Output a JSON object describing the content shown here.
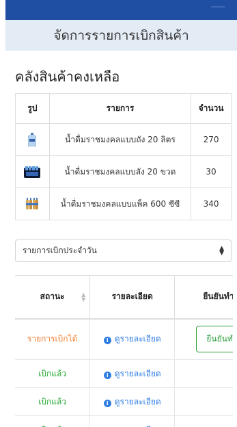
{
  "page_header": {
    "title": "จัดการรายการเบิกสินค้า"
  },
  "stock_section": {
    "title": "คลังสินค้าคงเหลือ",
    "columns": [
      "รูป",
      "รายการ",
      "จำนวน"
    ],
    "rows": [
      {
        "icon": "water-jug-icon",
        "name": "น้ำดื่มราชมงคลแบบถัง 20 ลิตร",
        "qty": "270"
      },
      {
        "icon": "bottle-crate-icon",
        "name": "น้ำดื่มราชมงคลแบบลัง 20 ขวด",
        "qty": "30"
      },
      {
        "icon": "bottle-pack-icon",
        "name": "น้ำดื่มราชมงคลแบบแพ็ค 600 ซีซี",
        "qty": "340"
      }
    ]
  },
  "filter": {
    "selected": "รายการเบิกประจำวัน"
  },
  "requests": {
    "columns": [
      "สถานะ",
      "รายละเอียด",
      "ยืนยันทำก"
    ],
    "detail_label": "ดูรายละเอียด",
    "confirm_label": "ยืนยันทำก",
    "rows": [
      {
        "status": "รายการเบิกได้",
        "status_color": "#f07f2f",
        "has_confirm": true
      },
      {
        "status": "เบิกแล้ว",
        "status_color": "#1aa52a",
        "has_confirm": false
      },
      {
        "status": "เบิกแล้ว",
        "status_color": "#1aa52a",
        "has_confirm": false
      },
      {
        "status": "เบิกแล้ว",
        "status_color": "#1aa52a",
        "has_confirm": false
      }
    ]
  },
  "colors": {
    "navbar": "#1f4fa3",
    "header_bg": "#e3ebf5",
    "link": "#2d7de0"
  }
}
